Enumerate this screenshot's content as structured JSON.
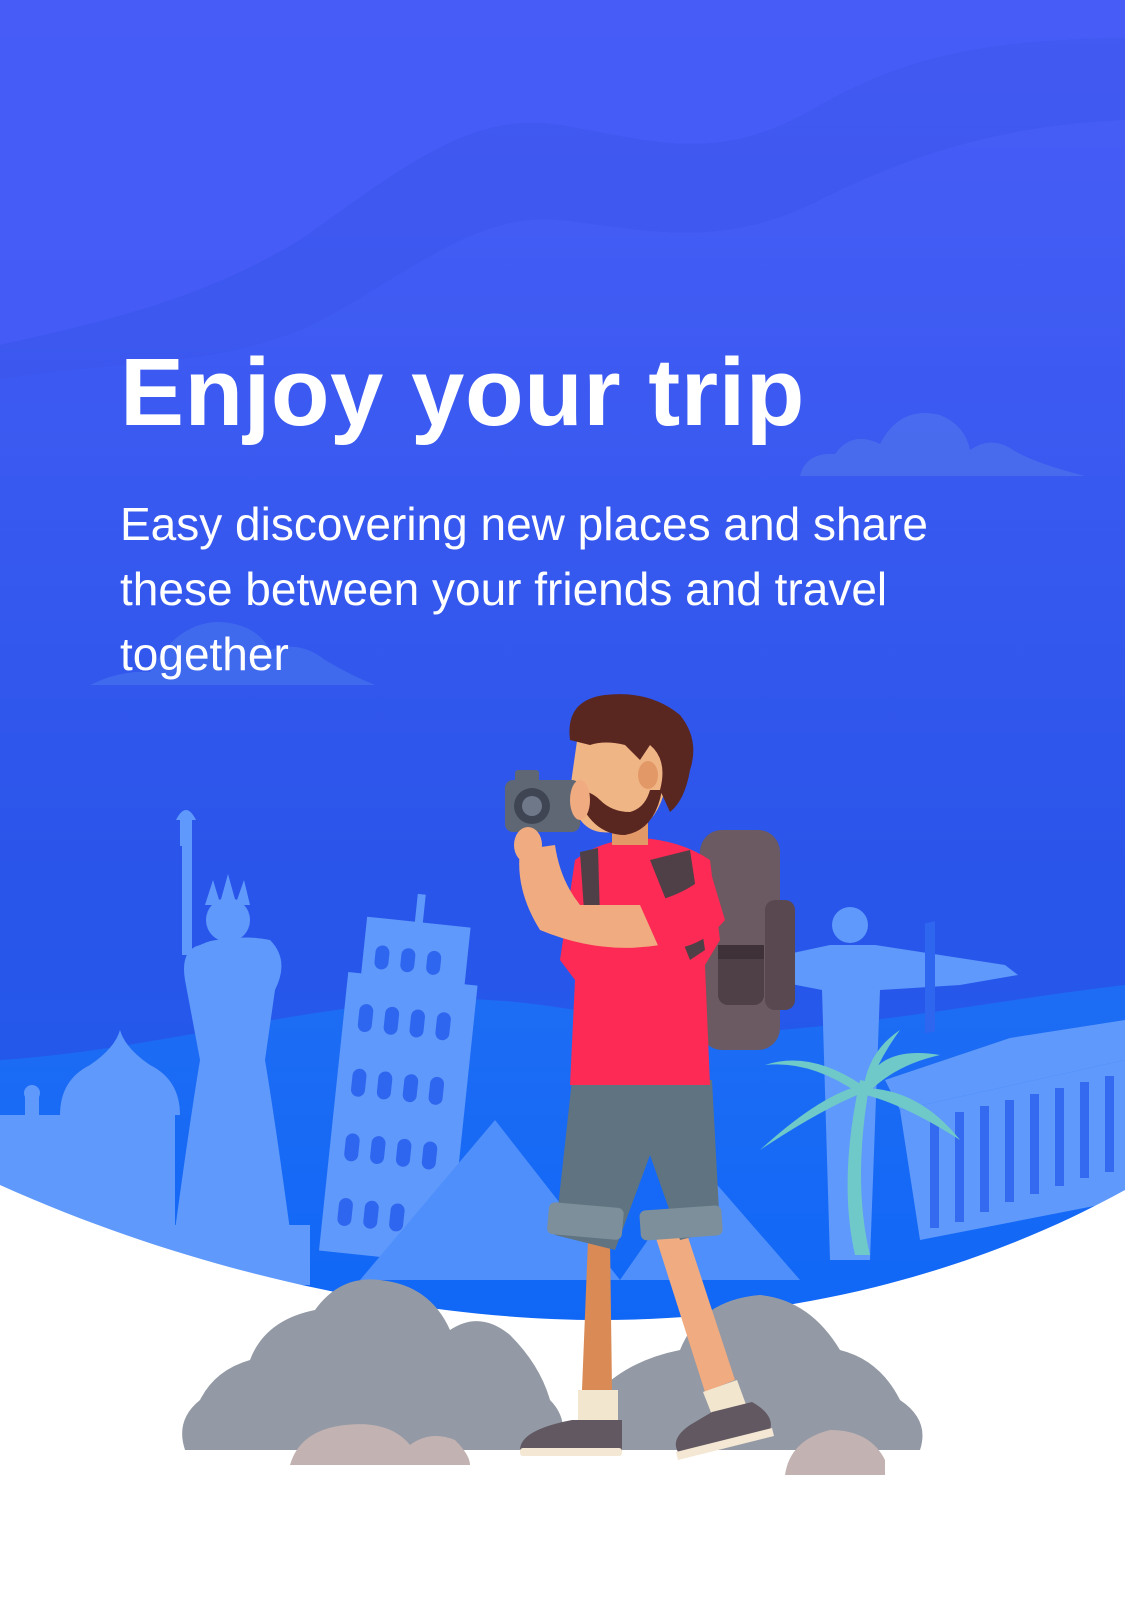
{
  "onboarding": {
    "title": "Enjoy your trip",
    "description": "Easy discovering new places and share these between your friends and travel together"
  },
  "illustration": {
    "subject": "traveler-with-camera",
    "landmarks": [
      "taj-mahal",
      "statue-of-liberty",
      "leaning-tower-of-pisa",
      "pyramid",
      "christ-the-redeemer",
      "palm-tree",
      "parthenon"
    ]
  },
  "colors": {
    "background_top": "#4a5ef7",
    "background_bottom": "#0f63ee",
    "landmark_fill": "#5f99fb",
    "shirt": "#fc2a54",
    "shorts": "#5f7480",
    "backpack": "#6b5a61",
    "rocks": "#939aa5",
    "palm": "#6fc9c8",
    "text": "#ffffff"
  }
}
